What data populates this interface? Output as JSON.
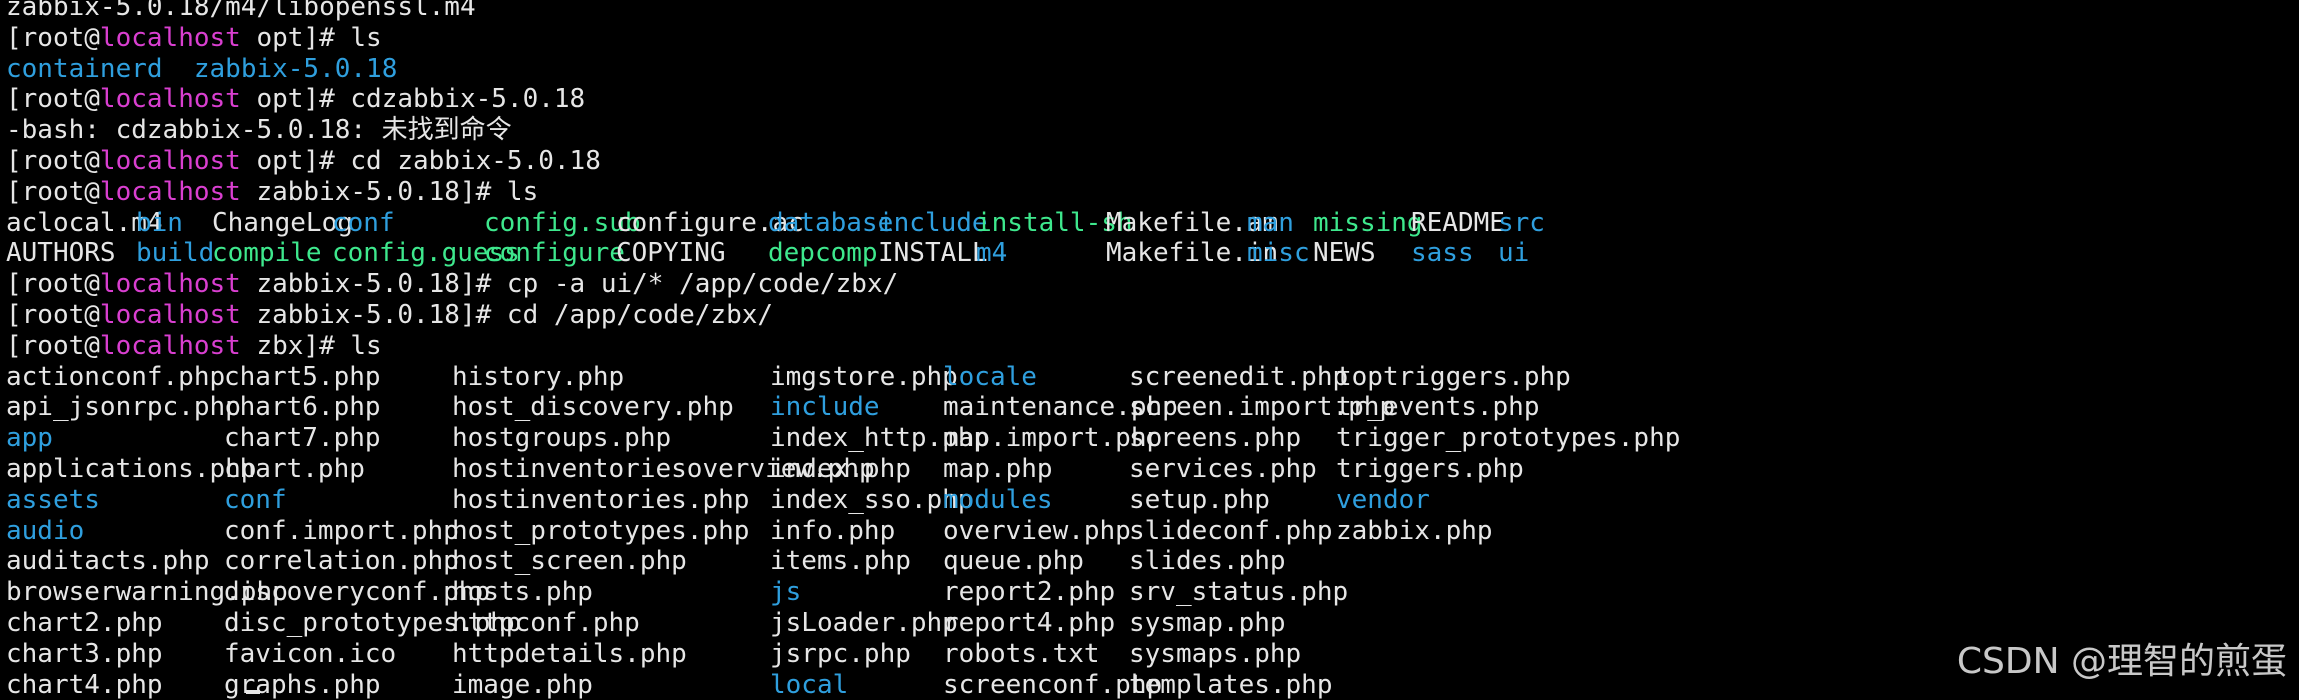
{
  "terminal": {
    "top_cut": "zabbix-5.0.18/m4/libopenssl.m4",
    "prompt": {
      "user": "root",
      "host": "localhost"
    },
    "colors": {
      "host": "#d93fd0",
      "dir": "#2f9fde",
      "exec": "#3ee88d",
      "text": "#e6e6e6"
    },
    "blocks": [
      {
        "cwd": "opt",
        "cmd": "ls"
      },
      {
        "output": [
          [
            {
              "t": "containerd",
              "k": "d"
            },
            {
              "t": "zabbix-5.0.18",
              "k": "d"
            }
          ]
        ]
      },
      {
        "cwd": "opt",
        "cmd": "cdzabbix-5.0.18"
      },
      {
        "plain": "-bash: cdzabbix-5.0.18: 未找到命令"
      },
      {
        "cwd": "opt",
        "cmd": "cd zabbix-5.0.18"
      },
      {
        "cwd": "zabbix-5.0.18",
        "cmd": "ls"
      }
    ],
    "ls1": {
      "cols": [
        0,
        130,
        206,
        326,
        478,
        610,
        762,
        872,
        970,
        1100,
        1241,
        1307,
        1405,
        1492
      ],
      "rows": [
        [
          [
            "aclocal.m4",
            "f"
          ],
          [
            "bin",
            "d"
          ],
          [
            "ChangeLog",
            "f"
          ],
          [
            "conf",
            "d"
          ],
          [
            "config.sub",
            "x"
          ],
          [
            "configure.ac",
            "f"
          ],
          [
            "database",
            "d"
          ],
          [
            "include",
            "d"
          ],
          [
            "install-sh",
            "x"
          ],
          [
            "Makefile.am",
            "f"
          ],
          [
            "man",
            "d"
          ],
          [
            "missing",
            "x"
          ],
          [
            "README",
            "f"
          ],
          [
            "src",
            "d"
          ]
        ],
        [
          [
            "AUTHORS",
            "f"
          ],
          [
            "build",
            "d"
          ],
          [
            "compile",
            "x"
          ],
          [
            "config.guess",
            "x"
          ],
          [
            "configure",
            "x"
          ],
          [
            "COPYING",
            "f"
          ],
          [
            "depcomp",
            "x"
          ],
          [
            "INSTALL",
            "f"
          ],
          [
            "m4",
            "d"
          ],
          [
            "Makefile.in",
            "f"
          ],
          [
            "misc",
            "d"
          ],
          [
            "NEWS",
            "f"
          ],
          [
            "sass",
            "d"
          ],
          [
            "ui",
            "d"
          ]
        ]
      ]
    },
    "after_ls1": [
      {
        "cwd": "zabbix-5.0.18",
        "cmd": "cp -a ui/* /app/code/zbx/"
      },
      {
        "cwd": "zabbix-5.0.18",
        "cmd": "cd /app/code/zbx/"
      },
      {
        "cwd": "zbx",
        "cmd": "ls"
      }
    ],
    "ls2": {
      "cols": [
        0,
        218,
        446,
        764,
        937,
        1123,
        1330
      ],
      "rows": [
        [
          [
            "actionconf.php",
            "f"
          ],
          [
            "chart5.php",
            "f"
          ],
          [
            "history.php",
            "f"
          ],
          [
            "imgstore.php",
            "f"
          ],
          [
            "locale",
            "d"
          ],
          [
            "screenedit.php",
            "f"
          ],
          [
            "toptriggers.php",
            "f"
          ]
        ],
        [
          [
            "api_jsonrpc.php",
            "f"
          ],
          [
            "chart6.php",
            "f"
          ],
          [
            "host_discovery.php",
            "f"
          ],
          [
            "include",
            "d"
          ],
          [
            "maintenance.php",
            "f"
          ],
          [
            "screen.import.php",
            "f"
          ],
          [
            "tr_events.php",
            "f"
          ]
        ],
        [
          [
            "app",
            "d"
          ],
          [
            "chart7.php",
            "f"
          ],
          [
            "hostgroups.php",
            "f"
          ],
          [
            "index_http.php",
            "f"
          ],
          [
            "map.import.php",
            "f"
          ],
          [
            "screens.php",
            "f"
          ],
          [
            "trigger_prototypes.php",
            "f"
          ]
        ],
        [
          [
            "applications.php",
            "f"
          ],
          [
            "chart.php",
            "f"
          ],
          [
            "hostinventoriesoverview.php",
            "f"
          ],
          [
            "index.php",
            "f"
          ],
          [
            "map.php",
            "f"
          ],
          [
            "services.php",
            "f"
          ],
          [
            "triggers.php",
            "f"
          ]
        ],
        [
          [
            "assets",
            "d"
          ],
          [
            "conf",
            "d"
          ],
          [
            "hostinventories.php",
            "f"
          ],
          [
            "index_sso.php",
            "f"
          ],
          [
            "modules",
            "d"
          ],
          [
            "setup.php",
            "f"
          ],
          [
            "vendor",
            "d"
          ]
        ],
        [
          [
            "audio",
            "d"
          ],
          [
            "conf.import.php",
            "f"
          ],
          [
            "host_prototypes.php",
            "f"
          ],
          [
            "info.php",
            "f"
          ],
          [
            "overview.php",
            "f"
          ],
          [
            "slideconf.php",
            "f"
          ],
          [
            "zabbix.php",
            "f"
          ]
        ],
        [
          [
            "auditacts.php",
            "f"
          ],
          [
            "correlation.php",
            "f"
          ],
          [
            "host_screen.php",
            "f"
          ],
          [
            "items.php",
            "f"
          ],
          [
            "queue.php",
            "f"
          ],
          [
            "slides.php",
            "f"
          ]
        ],
        [
          [
            "browserwarning.php",
            "f"
          ],
          [
            "discoveryconf.php",
            "f"
          ],
          [
            "hosts.php",
            "f"
          ],
          [
            "js",
            "d"
          ],
          [
            "report2.php",
            "f"
          ],
          [
            "srv_status.php",
            "f"
          ]
        ],
        [
          [
            "chart2.php",
            "f"
          ],
          [
            "disc_prototypes.php",
            "f"
          ],
          [
            "httpconf.php",
            "f"
          ],
          [
            "jsLoader.php",
            "f"
          ],
          [
            "report4.php",
            "f"
          ],
          [
            "sysmap.php",
            "f"
          ]
        ],
        [
          [
            "chart3.php",
            "f"
          ],
          [
            "favicon.ico",
            "f"
          ],
          [
            "httpdetails.php",
            "f"
          ],
          [
            "jsrpc.php",
            "f"
          ],
          [
            "robots.txt",
            "f"
          ],
          [
            "sysmaps.php",
            "f"
          ]
        ],
        [
          [
            "chart4.php",
            "f"
          ],
          [
            "graphs.php",
            "f"
          ],
          [
            "image.php",
            "f"
          ],
          [
            "local",
            "d"
          ],
          [
            "screenconf.php",
            "f"
          ],
          [
            "templates.php",
            "f"
          ]
        ]
      ]
    }
  },
  "watermark": "CSDN @理智的煎蛋"
}
